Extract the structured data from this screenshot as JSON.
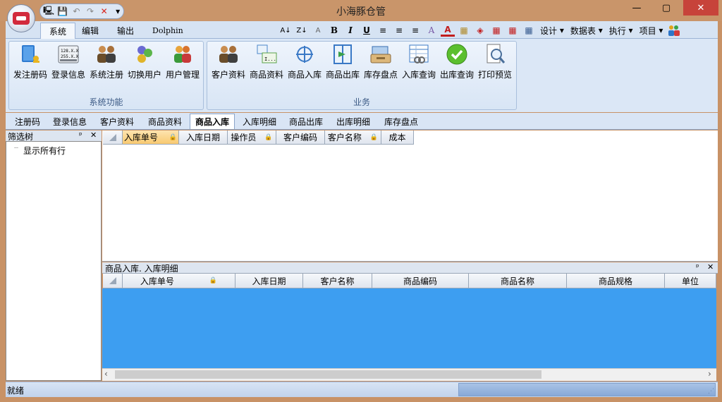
{
  "window": {
    "title": "小海豚仓管",
    "minimize_label": "—",
    "maximize_label": "▢",
    "close_label": "✕"
  },
  "quick_access": {
    "items": [
      {
        "name": "computer-icon",
        "glyph": "🖳"
      },
      {
        "name": "save-icon",
        "glyph": "💾"
      },
      {
        "name": "undo-icon",
        "glyph": "↶"
      },
      {
        "name": "redo-icon",
        "glyph": "↷"
      },
      {
        "name": "delete-icon",
        "glyph": "✕"
      },
      {
        "name": "customize-icon",
        "glyph": "▾"
      }
    ]
  },
  "ribbon_tabs": [
    "系统",
    "编辑",
    "输出",
    "Dolphin"
  ],
  "format_toolbar": {
    "buttons": [
      "A↓",
      "Z↓",
      "A",
      "B",
      "I",
      "U",
      "≡",
      "≡",
      "≡",
      "A",
      "A",
      "▦",
      "◈",
      "▦",
      "▦",
      "▦"
    ],
    "menus": [
      "设计",
      "数据表",
      "执行",
      "项目"
    ]
  },
  "groups": [
    {
      "label": "系统功能",
      "buttons": [
        {
          "label": "发注册码",
          "icon": "key-book-icon"
        },
        {
          "label": "登录信息",
          "icon": "license-card-icon"
        },
        {
          "label": "系统注册",
          "icon": "users-register-icon"
        },
        {
          "label": "切换用户",
          "icon": "switch-user-icon"
        },
        {
          "label": "用户管理",
          "icon": "user-manage-icon"
        }
      ]
    },
    {
      "label": "业务",
      "buttons": [
        {
          "label": "客户资料",
          "icon": "customers-icon"
        },
        {
          "label": "商品资料",
          "icon": "product-info-icon"
        },
        {
          "label": "商品入库",
          "icon": "stock-in-icon"
        },
        {
          "label": "商品出库",
          "icon": "stock-out-icon"
        },
        {
          "label": "库存盘点",
          "icon": "inventory-icon"
        },
        {
          "label": "入库查询",
          "icon": "query-in-icon"
        },
        {
          "label": "出库查询",
          "icon": "query-out-icon"
        },
        {
          "label": "打印预览",
          "icon": "print-preview-icon"
        }
      ]
    }
  ],
  "document_tabs": [
    "注册码",
    "登录信息",
    "客户资料",
    "商品资料",
    "商品入库",
    "入库明细",
    "商品出库",
    "出库明细",
    "库存盘点"
  ],
  "active_document_tab": "商品入库",
  "tree": {
    "title": "筛选树",
    "pin_label": "ᵖ",
    "close_label": "✕",
    "items": [
      "显示所有行"
    ]
  },
  "main_grid": {
    "columns": [
      "入库单号",
      "入库日期",
      "操作员",
      "客户编码",
      "客户名称",
      "成本"
    ]
  },
  "detail": {
    "title": "商品入库. 入库明细",
    "columns": [
      "入库单号",
      "入库日期",
      "客户名称",
      "商品编码",
      "商品名称",
      "商品规格",
      "单位"
    ]
  },
  "status": {
    "text": "就绪"
  },
  "colors": {
    "accent": "#3d9ef1",
    "titlebar": "#c9956a",
    "close": "#c7433a"
  }
}
